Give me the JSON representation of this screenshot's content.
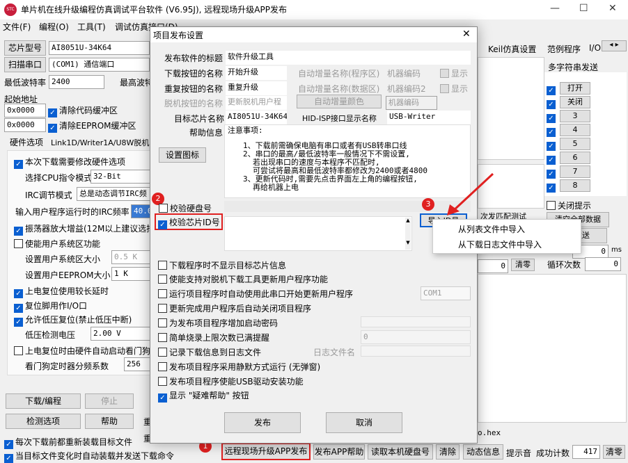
{
  "app": {
    "title": "单片机在线升级编程仿真调试平台软件 (V6.95J), 远程现场升级APP发布",
    "logo": "STC"
  },
  "menu": [
    "文件(F)",
    "编程(O)",
    "工具(T)",
    "调试仿真接口(D)",
    "资料下载(R)",
    "USB驱动安装(R)",
    "AiCube(A)",
    "English"
  ],
  "left": {
    "chip_label": "芯片型号",
    "chip": "AI8051U-34K64",
    "scan_label": "扫描串口",
    "port": "(COM1) 通信端口",
    "min_baud_label": "最低波特率",
    "min_baud": "2400",
    "max_baud_label": "最高波特",
    "start_addr_label": "起始地址",
    "addr1": "0x0000",
    "clear_code": "清除代码缓冲区",
    "addr2": "0x0000",
    "clear_eeprom": "清除EEPROM缓冲区",
    "tab1": "硬件选项",
    "tab2": "Link1D/Writer1A/U8W脱机",
    "opts": {
      "modify_hw": "本次下载需要修改硬件选项",
      "cpu_mode_label": "选择CPU指令模式",
      "cpu_mode": "32-Bit",
      "irc_mode_label": "IRC调节模式",
      "irc_mode": "总是动态调节IRC频",
      "irc_freq_label": "输入用户程序运行时的IRC频率",
      "irc_freq": "40.0",
      "osc_gain": "振荡器放大增益(12M以上建议选择",
      "sys_area": "使能用户系统区功能",
      "sys_size_label": "设置用户系统区大小",
      "sys_size": "0.5 K",
      "eeprom_size_label": "设置用户EEPROM大小",
      "eeprom_size": "1 K",
      "long_delay": "上电复位使用较长延时",
      "reset_io": "复位脚用作I/O口",
      "low_volt_reset": "允许低压复位(禁止低压中断)",
      "low_volt_label": "低压检测电压",
      "low_volt": "2.00 V",
      "wdt_start": "上电复位时由硬件自动启动看门狗",
      "wdt_div_label": "看门狗定时器分频系数",
      "wdt_div": "256"
    },
    "btn_download": "下载/编程",
    "btn_stop": "停止",
    "btn_check": "检测选项",
    "btn_help": "帮助",
    "auto_reload": "每次下载前都重新装载目标文件",
    "auto_send": "当目标文件变化时自动装载并发送下载命令",
    "btn_weight": "重",
    "btn_weight2": "重"
  },
  "right": {
    "tabs": [
      "Keil仿真设置",
      "范例程序",
      "I/O"
    ],
    "multi_send_title": "多字符串发送",
    "send_buttons": [
      "打开",
      "关闭",
      "3",
      "4",
      "5",
      "6",
      "7",
      "8"
    ],
    "close_prompt": "关闭提示",
    "clear_all": "清空全部数据",
    "send": "发送",
    "auto_send": "自动发送",
    "period": "周期",
    "period_val": "0",
    "ms": "ms",
    "send_count": "0",
    "clear": "清零",
    "loop_count_label": "循环次数",
    "loop_count": "0",
    "hex_file": "o.hex",
    "match_test": "次发匹配测试"
  },
  "bottom": {
    "publish_app": "远程现场升级APP发布",
    "publish_help": "发布APP帮助",
    "read_disk": "读取本机硬盘号",
    "clear": "清除",
    "log": "动态信息",
    "sound": "提示音",
    "success_label": "成功计数",
    "success": "417",
    "clear_btn": "清零"
  },
  "dialog": {
    "title": "项目发布设置",
    "pub_title_label": "发布软件的标题",
    "pub_title": "软件升级工具",
    "dl_btn_label": "下载按钮的名称",
    "dl_btn": "开始升级",
    "auto_inc_prog": "自动增量名称(程序区)",
    "machine_code": "机器编码",
    "show1": "显示",
    "redl_btn_label": "重复按钮的名称",
    "redl_btn": "重复升级",
    "auto_inc_data": "自动增量名称(数据区)",
    "machine_code2": "机器编码2",
    "show2": "显示",
    "offline_label": "脱机按钮的名称",
    "offline": "更新脱机用户程",
    "auto_inc_color": "自动增量颜色",
    "machine_code3": "机器编码",
    "target_chip_label": "目标芯片名称",
    "target_chip": "AI8051U-34K64",
    "hid_label": "HID-ISP接口显示名称",
    "hid": "USB-Writer",
    "help_label": "帮助信息",
    "set_icon": "设置图标",
    "help_lines": [
      "注意事项:",
      "1、下载前需确保电脑有串口或者有USB转串口线",
      "2、串口的最高/最低波特率一般情况下不需设置,",
      "若出现串口的速度与本程序不匹配时,",
      "可尝试将最高和最低波特率都修改为2400或者4800",
      "3、更新代码时,需要先点击界面左上角的编程按钮,",
      "再给机器上电"
    ],
    "verify_disk": "校验硬盘号",
    "verify_chip": "校验芯片ID号",
    "import_btn": "导入ID号",
    "opts": [
      "下载程序时不显示目标芯片信息",
      "使能支持对脱机下载工具更新用户程序功能",
      "运行项目程序时自动使用此串口开始更新用户程序",
      "更新完成用户程序后自动关闭项目程序",
      "为发布项目程序增加启动密码",
      "简单烧录上限次数已满提醒",
      "记录下载信息到日志文件",
      "发布项目程序采用静默方式运行 (无弹窗)",
      "发布项目程序使能USB驱动安装功能",
      "显示 \"疑难帮助\" 按钮"
    ],
    "com": "COM1",
    "limit": "0",
    "log_name_label": "日志文件名",
    "btn_publish": "发布",
    "btn_cancel": "取消"
  },
  "context_menu": [
    "从列表文件中导入",
    "从下载日志文件中导入"
  ],
  "badges": [
    "1",
    "2",
    "3"
  ],
  "colors": {
    "accent": "#0a5fd1",
    "highlight": "#e02020"
  }
}
